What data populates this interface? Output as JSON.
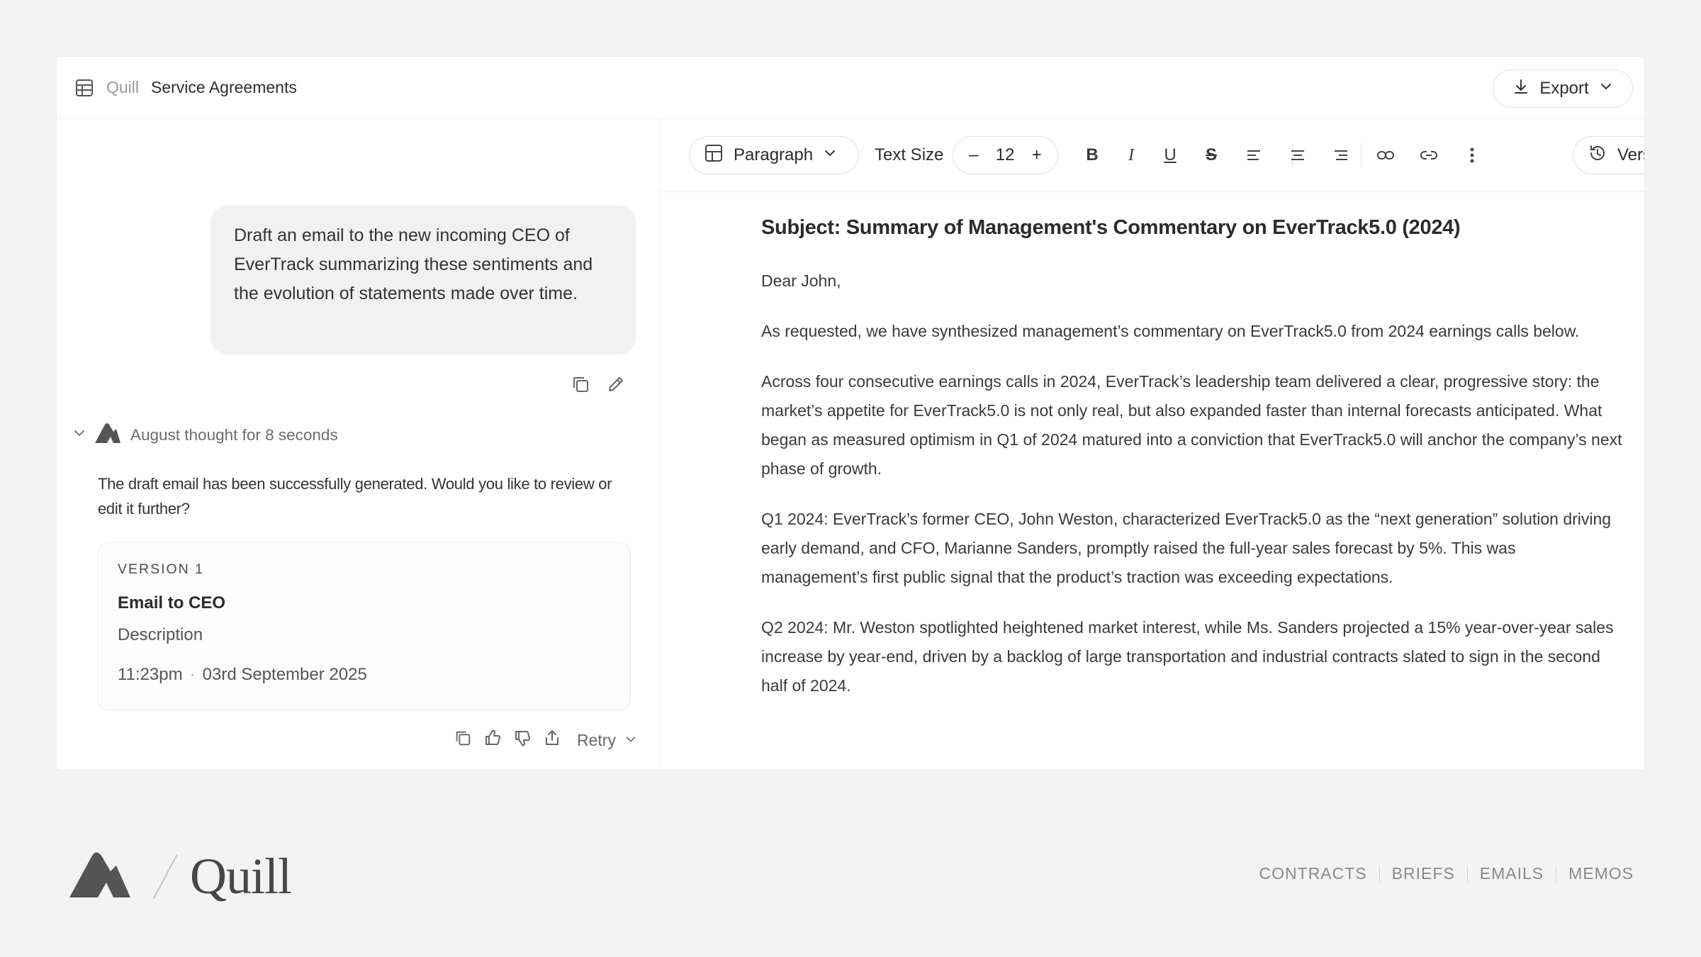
{
  "topbar": {
    "root": "Quill",
    "page": "Service Agreements",
    "export_label": "Export"
  },
  "chat": {
    "user_message": "Draft an email to the new incoming CEO of EverTrack summarizing these sentiments and the evolution of statements made over time.",
    "thought_label": "August thought for 8 seconds",
    "reply": "The draft email has been successfully generated. Would you like to review or edit it further?",
    "version_card": {
      "tag": "VERSION 1",
      "title": "Email to CEO",
      "description": "Description",
      "time": "11:23pm",
      "date": "03rd September 2025"
    },
    "retry_label": "Retry"
  },
  "toolbar": {
    "block_style": "Paragraph",
    "text_size_label": "Text Size",
    "text_size_value": "12",
    "version_label": "Version"
  },
  "document": {
    "subject": "Subject: Summary of Management's Commentary on EverTrack5.0 (2024)",
    "greeting": "Dear John,",
    "paragraphs": [
      "As requested, we have synthesized management’s commentary on EverTrack5.0 from 2024 earnings calls below.",
      "Across four consecutive earnings calls in 2024, EverTrack’s leadership team delivered a clear, progressive story: the market’s appetite for EverTrack5.0 is not only real, but also expanded faster than internal forecasts anticipated. What began as measured optimism in Q1 of 2024 matured into a conviction that EverTrack5.0 will anchor the company’s next phase of growth.",
      "Q1 2024: EverTrack’s former CEO, John Weston, characterized EverTrack5.0 as the “next generation” solution driving early demand, and CFO, Marianne Sanders, promptly raised the full-year sales forecast by 5%. This was management’s first public signal that the product’s traction was exceeding expectations.",
      "Q2 2024: Mr. Weston spotlighted heightened market interest, while Ms. Sanders projected a 15% year-over-year sales increase by year-end, driven by a backlog of large transportation and industrial contracts slated to sign in the second half of 2024."
    ]
  },
  "footer": {
    "wordmark": "Quill",
    "nav": [
      "CONTRACTS",
      "BRIEFS",
      "EMAILS",
      "MEMOS"
    ]
  }
}
